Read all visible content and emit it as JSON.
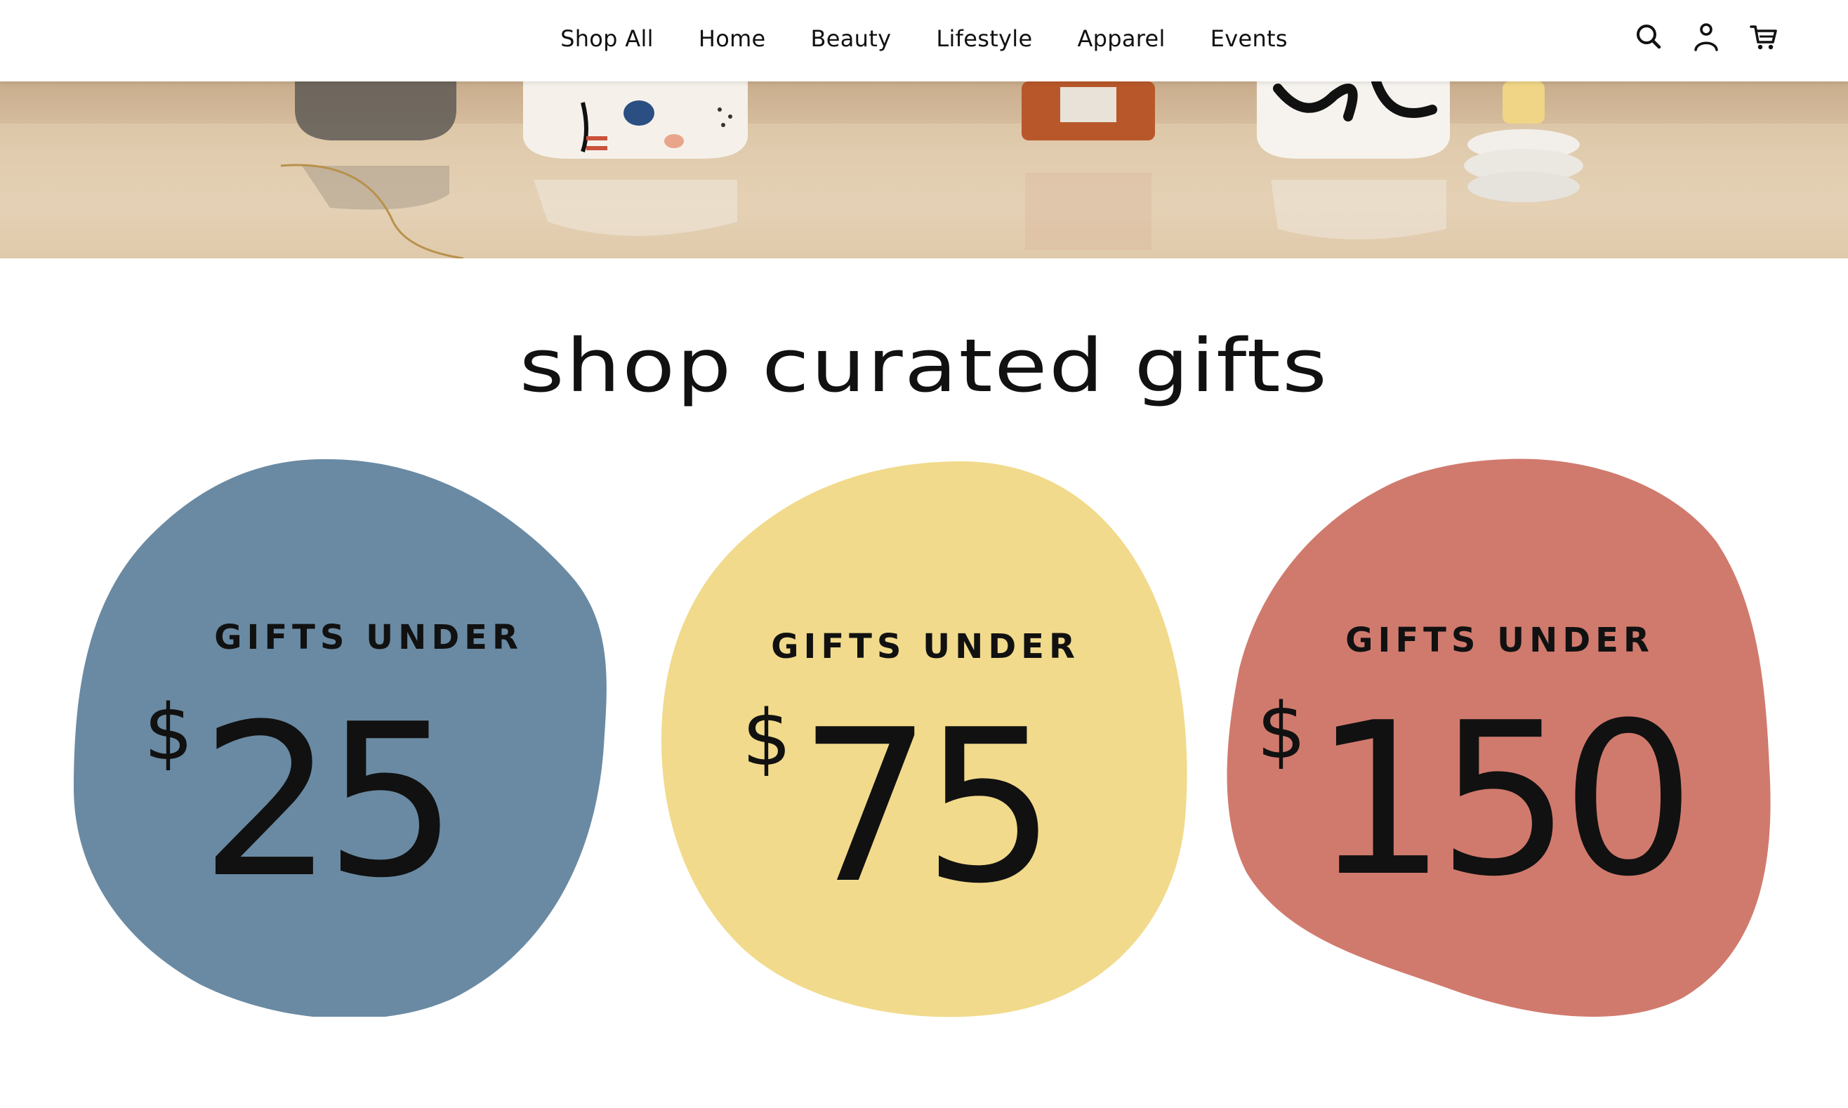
{
  "nav": {
    "items": [
      "Shop All",
      "Home",
      "Beauty",
      "Lifestyle",
      "Apparel",
      "Events"
    ],
    "icons": [
      "search-icon",
      "account-icon",
      "cart-icon"
    ]
  },
  "hero": {
    "alt": ""
  },
  "section": {
    "title": "shop curated gifts"
  },
  "gifts": [
    {
      "label": "GIFTS UNDER",
      "currency": "$",
      "amount": "25",
      "color": "#6a8aa3"
    },
    {
      "label": "GIFTS UNDER",
      "currency": "$",
      "amount": "75",
      "color": "#f1da8b"
    },
    {
      "label": "GIFTS UNDER",
      "currency": "$",
      "amount": "150",
      "color": "#d07a6d"
    }
  ]
}
